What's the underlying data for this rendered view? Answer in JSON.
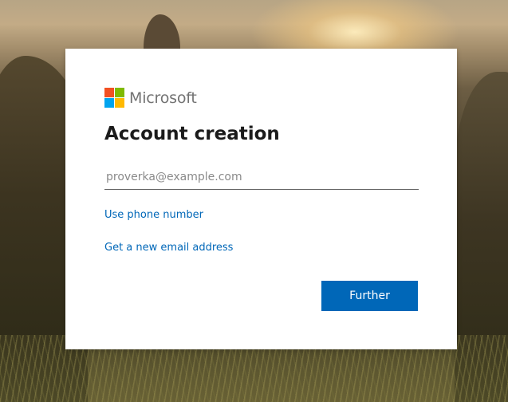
{
  "brand": {
    "name": "Microsoft",
    "logo_colors": [
      "#f25022",
      "#7fba00",
      "#00a4ef",
      "#ffb900"
    ]
  },
  "form": {
    "title": "Account creation",
    "email_placeholder": "proverka@example.com",
    "email_value": "",
    "phone_link": "Use phone number",
    "new_email_link": "Get a new email address",
    "submit_label": "Further"
  },
  "colors": {
    "accent": "#0067b8",
    "title_text": "#1b1b1b",
    "brand_text": "#737373"
  }
}
